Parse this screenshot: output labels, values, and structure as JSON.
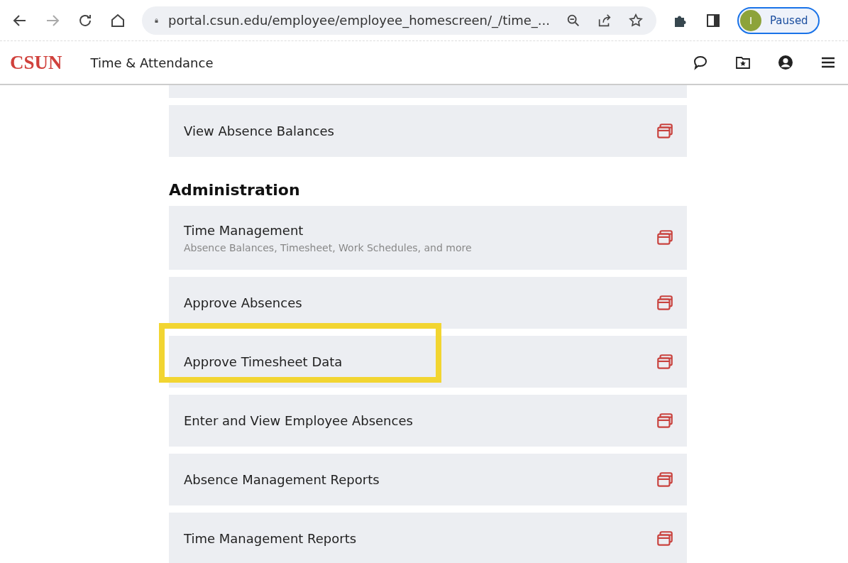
{
  "browser": {
    "url": "portal.csun.edu/employee/employee_homescreen/_/time_...",
    "profile_initial": "I",
    "profile_status": "Paused"
  },
  "header": {
    "logo": "CSUN",
    "title": "Time & Attendance"
  },
  "sections": [
    {
      "items": [
        {
          "title": "View Absence Balances",
          "highlighted": false
        }
      ]
    },
    {
      "heading": "Administration",
      "items": [
        {
          "title": "Time Management",
          "subtitle": "Absence Balances, Timesheet, Work Schedules, and more",
          "highlighted": false
        },
        {
          "title": "Approve Absences",
          "highlighted": false
        },
        {
          "title": "Approve Timesheet Data",
          "highlighted": true
        },
        {
          "title": "Enter and View Employee Absences",
          "highlighted": false
        },
        {
          "title": "Absence Management Reports",
          "highlighted": false
        },
        {
          "title": "Time Management Reports",
          "highlighted": false
        }
      ]
    }
  ]
}
